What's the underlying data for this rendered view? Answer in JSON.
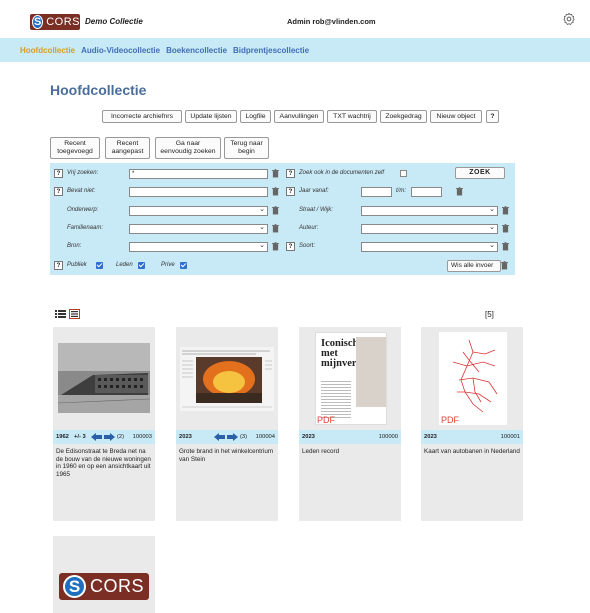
{
  "header": {
    "logo_text": "CORS",
    "logo_letter": "S",
    "app_title": "Demo Collectie",
    "user": "Admin rob@vlinden.com",
    "settings_icon": "gear-icon"
  },
  "nav": {
    "tabs": [
      {
        "label": "Hoofdcollectie",
        "active": true
      },
      {
        "label": "Audio-Videocollectie",
        "active": false
      },
      {
        "label": "Boekencollectie",
        "active": false
      },
      {
        "label": "Bidprentjescollectie",
        "active": false
      }
    ]
  },
  "page_title": "Hoofdcollectie",
  "toolbar": {
    "buttons": [
      "Incorrecte archiefnrs",
      "Update lijsten",
      "Logfile",
      "Aanvullingen",
      "TXT wachtrij",
      "Zoekgedrag",
      "Nieuw object",
      "?"
    ]
  },
  "quick_buttons": {
    "recent_added": "Recent\ntoegevoegd",
    "recent_changed": "Recent\naangepast",
    "simple_search": "Ga naar\neenvoudig zoeken",
    "back_start": "Terug naar\nbegin"
  },
  "search": {
    "help": "?",
    "free_search_label": "Vrij zoeken:",
    "free_search_value": "*",
    "doc_search_label": "Zoek ook in de documenten zelf",
    "search_button": "ZOEK",
    "not_contains_label": "Bevat niet:",
    "year_from_label": "Jaar vanaf:",
    "year_to_label": "t/m:",
    "subject_label": "Onderwerp:",
    "street_label": "Straat / Wijk:",
    "family_label": "Familienaam:",
    "author_label": "Auteur:",
    "source_label": "Bron:",
    "type_label": "Soort:",
    "public_label": "Publiek",
    "members_label": "Leden",
    "private_label": "Prive",
    "clear_all": "Wis alle invoer"
  },
  "results": {
    "count": "[5]",
    "items": [
      {
        "year": "1962",
        "pm": "+/- 3",
        "count": "(2)",
        "id": "100003",
        "caption": "De Edisonstraat te Breda net na de bouw van de nieuwe woningen in 1960 en op een ansichtkaart uit 1965"
      },
      {
        "year": "2023",
        "pm": "",
        "count": "(3)",
        "id": "100004",
        "caption": "Grote brand in het winkelcentrium van Stein"
      },
      {
        "year": "2023",
        "pm": "",
        "count": "",
        "id": "100000",
        "caption": "Leden record",
        "pdf": "PDF",
        "doc_title": "Iconisch bos met mijnverleden"
      },
      {
        "year": "2023",
        "pm": "",
        "count": "",
        "id": "100001",
        "caption": "Kaart van autobanen in Nederland",
        "pdf": "PDF"
      }
    ],
    "logo_card": {
      "logo_letter": "S",
      "logo_text": "CORS"
    }
  }
}
